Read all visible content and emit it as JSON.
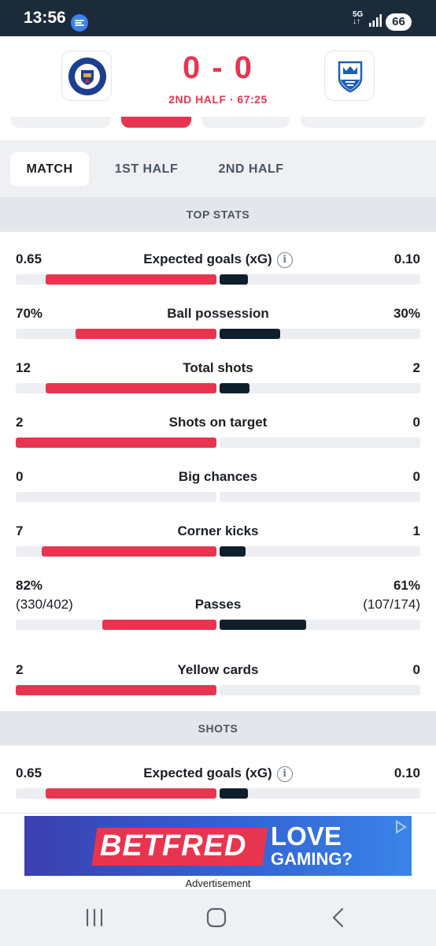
{
  "status_bar": {
    "time": "13:56",
    "network": "5G",
    "battery": "66",
    "icons": [
      "app-notification-icon",
      "signal-icon",
      "battery-icon"
    ]
  },
  "match": {
    "home_score": "0",
    "away_score": "0",
    "score_separator": "-",
    "period_text": "2ND HALF · 67:25",
    "home_crest": "stockport-county-crest-icon",
    "away_crest": "huddersfield-town-crest-icon"
  },
  "period_tabs": {
    "items": [
      "MATCH",
      "1ST HALF",
      "2ND HALF"
    ],
    "selected": "MATCH"
  },
  "sections": {
    "top_stats": "TOP STATS",
    "shots": "SHOTS"
  },
  "top_stats": [
    {
      "label": "Expected goals (xG)",
      "home": "0.65",
      "away": "0.10",
      "home_share": 0.85,
      "away_share": 0.14,
      "info": true
    },
    {
      "label": "Ball possession",
      "home": "70%",
      "away": "30%",
      "home_share": 0.7,
      "away_share": 0.3
    },
    {
      "label": "Total shots",
      "home": "12",
      "away": "2",
      "home_share": 0.85,
      "away_share": 0.15
    },
    {
      "label": "Shots on target",
      "home": "2",
      "away": "0",
      "home_share": 1.0,
      "away_share": 0.0
    },
    {
      "label": "Big chances",
      "home": "0",
      "away": "0",
      "home_share": 0.0,
      "away_share": 0.0
    },
    {
      "label": "Corner kicks",
      "home": "7",
      "away": "1",
      "home_share": 0.87,
      "away_share": 0.13
    },
    {
      "label": "Passes",
      "home": "82%",
      "home_sub": "(330/402)",
      "away": "61%",
      "away_sub": "(107/174)",
      "home_share": 0.57,
      "away_share": 0.43
    },
    {
      "label": "Yellow cards",
      "home": "2",
      "away": "0",
      "home_share": 1.0,
      "away_share": 0.0
    }
  ],
  "shots_stats": [
    {
      "label": "Expected goals (xG)",
      "home": "0.65",
      "away": "0.10",
      "home_share": 0.85,
      "away_share": 0.14,
      "info": true
    }
  ],
  "ad": {
    "brand": "BETFRED",
    "line1": "LOVE",
    "line2": "GAMING?",
    "caption": "Advertisement"
  },
  "colors": {
    "home": "#e8354f",
    "away": "#0f1f2c",
    "status_bar": "#1c2b3a"
  }
}
